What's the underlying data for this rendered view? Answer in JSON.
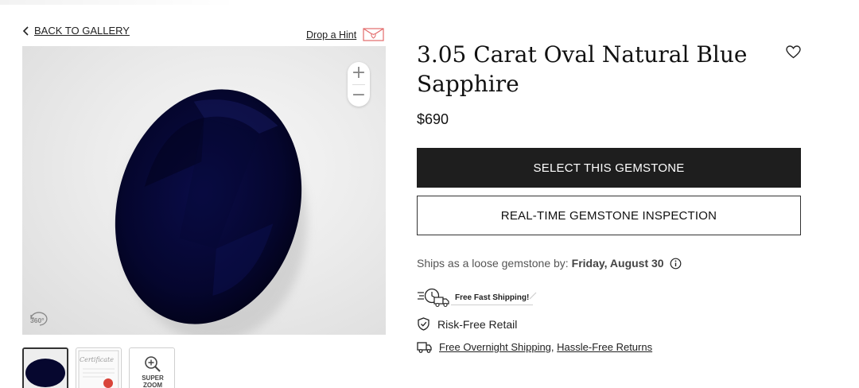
{
  "nav": {
    "back_label": "BACK TO GALLERY",
    "hint_label": "Drop a Hint"
  },
  "viewer": {
    "zoom_in": "+",
    "zoom_out": "−",
    "rotate_label": "360°"
  },
  "thumbnails": {
    "certificate_label": "Certificate",
    "superzoom_label_line1": "SUPER",
    "superzoom_label_line2": "ZOOM"
  },
  "product": {
    "title": "3.05 Carat Oval Natural Blue Sapphire",
    "price": "$690"
  },
  "actions": {
    "select_label": "SELECT THIS GEMSTONE",
    "inspect_label": "REAL-TIME GEMSTONE INSPECTION"
  },
  "shipping": {
    "ships_prefix": "Ships as a loose gemstone by:",
    "ships_date": "Friday, August 30",
    "badge_label": "Free Fast Shipping!",
    "risk_label": "Risk-Free Retail",
    "overnight_label": "Free Overnight Shipping",
    "separator": ",",
    "returns_label": "Hassle-Free Returns"
  },
  "colors": {
    "primary_button": "#1e1e1e",
    "gem": "#050735",
    "hint_icon": "#e36b6b"
  },
  "icons": [
    "chevron-left-icon",
    "envelope-heart-icon",
    "zoom-in-icon",
    "zoom-out-icon",
    "rotate-360-icon",
    "magnifier-icon",
    "heart-icon",
    "info-icon",
    "truck-clock-icon",
    "shield-check-icon",
    "truck-icon"
  ]
}
